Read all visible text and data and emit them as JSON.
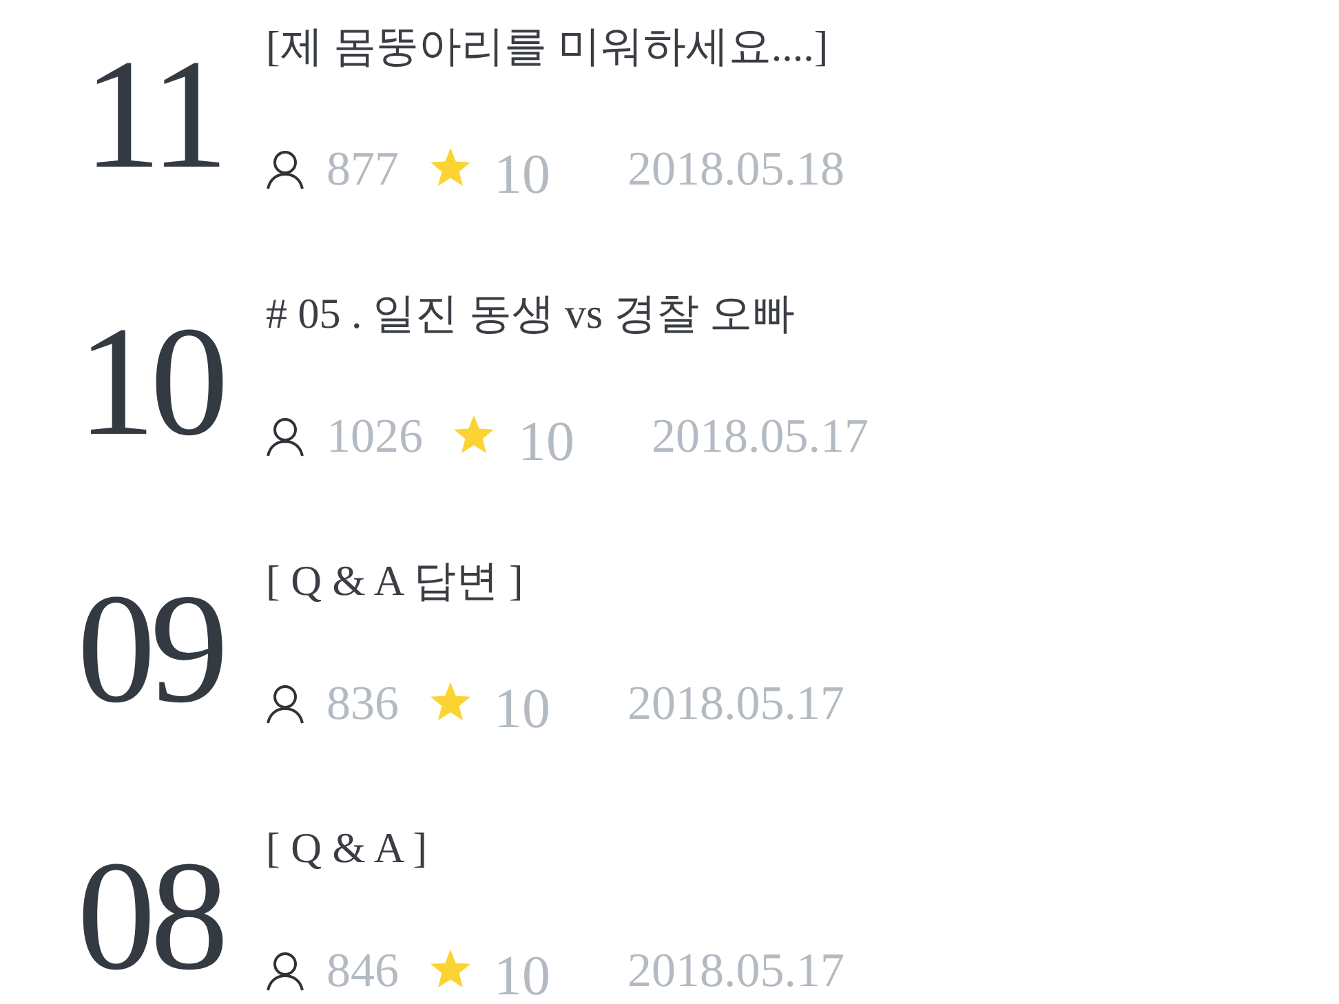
{
  "posts": [
    {
      "rank": "11",
      "title": "[제 몸뚱아리를 미워하세요....]",
      "views": "877",
      "rating": "10",
      "date": "2018.05.18"
    },
    {
      "rank": "10",
      "title": "# 05 . 일진 동생 vs 경찰 오빠",
      "views": "1026",
      "rating": "10",
      "date": "2018.05.17"
    },
    {
      "rank": "09",
      "title": "[ Q & A 답변 ]",
      "views": "836",
      "rating": "10",
      "date": "2018.05.17"
    },
    {
      "rank": "08",
      "title": "[ Q & A ]",
      "views": "846",
      "rating": "10",
      "date": "2018.05.17"
    }
  ]
}
